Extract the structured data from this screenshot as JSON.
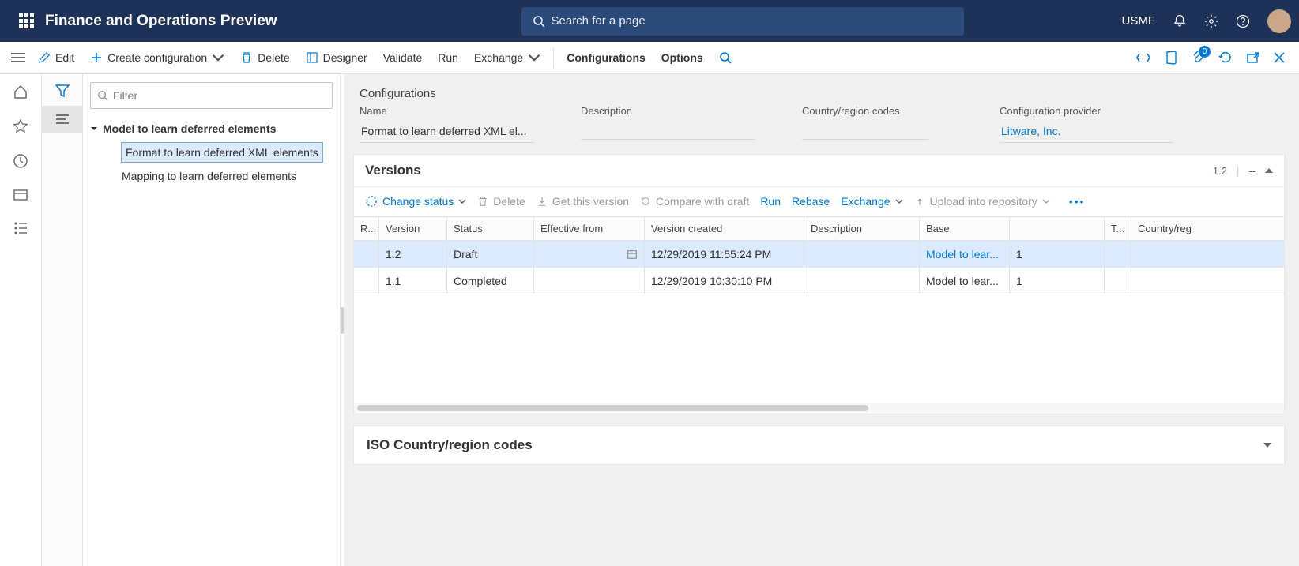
{
  "topbar": {
    "app_title": "Finance and Operations Preview",
    "search_placeholder": "Search for a page",
    "company": "USMF"
  },
  "cmdbar": {
    "edit": "Edit",
    "create": "Create configuration",
    "delete": "Delete",
    "designer": "Designer",
    "validate": "Validate",
    "run": "Run",
    "exchange": "Exchange",
    "configurations": "Configurations",
    "options": "Options",
    "attach_badge": "0"
  },
  "tree": {
    "filter_placeholder": "Filter",
    "root": "Model to learn deferred elements",
    "children": [
      "Format to learn deferred XML elements",
      "Mapping to learn deferred elements"
    ],
    "selected_index": 0
  },
  "main": {
    "title": "Configurations",
    "fields": {
      "name_label": "Name",
      "name_value": "Format to learn deferred XML el...",
      "description_label": "Description",
      "description_value": "",
      "crc_label": "Country/region codes",
      "crc_value": "",
      "provider_label": "Configuration provider",
      "provider_value": "Litware, Inc."
    }
  },
  "versions": {
    "title": "Versions",
    "head_right_ver": "1.2",
    "head_right_dash": "--",
    "toolbar": {
      "change_status": "Change status",
      "delete": "Delete",
      "get": "Get this version",
      "compare": "Compare with draft",
      "run": "Run",
      "rebase": "Rebase",
      "exchange": "Exchange",
      "upload": "Upload into repository"
    },
    "columns": {
      "mark": "R...",
      "version": "Version",
      "status": "Status",
      "effective": "Effective from",
      "created": "Version created",
      "description": "Description",
      "base": "Base",
      "t": "T...",
      "crc": "Country/reg"
    },
    "rows": [
      {
        "version": "1.2",
        "status": "Draft",
        "effective": "",
        "created": "12/29/2019 11:55:24 PM",
        "description": "",
        "base": "Model to lear...",
        "base_num": "1",
        "t": "",
        "crc": "",
        "selected": true,
        "link": true
      },
      {
        "version": "1.1",
        "status": "Completed",
        "effective": "",
        "created": "12/29/2019 10:30:10 PM",
        "description": "",
        "base": "Model to lear...",
        "base_num": "1",
        "t": "",
        "crc": "",
        "selected": false,
        "link": false
      }
    ]
  },
  "iso": {
    "title": "ISO Country/region codes"
  }
}
